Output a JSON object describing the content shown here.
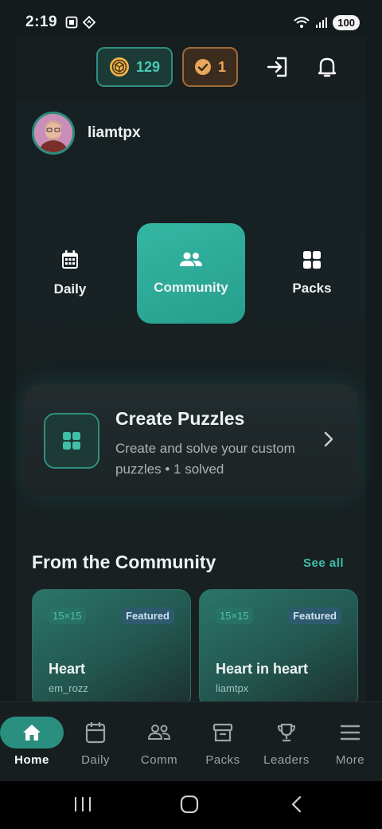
{
  "status_bar": {
    "time": "2:19",
    "battery": "100"
  },
  "header": {
    "coins": "129",
    "solved_badge": "1"
  },
  "profile": {
    "username": "liamtpx"
  },
  "modes": [
    {
      "label": "Daily"
    },
    {
      "label": "Community"
    },
    {
      "label": "Packs"
    }
  ],
  "create_card": {
    "title": "Create Puzzles",
    "subtitle": "Create and solve your custom puzzles • 1 solved"
  },
  "community": {
    "title": "From the Community",
    "see_all": "See all",
    "puzzles": [
      {
        "size": "15×15",
        "badge": "Featured",
        "name": "Heart",
        "author": "em_rozz"
      },
      {
        "size": "15×15",
        "badge": "Featured",
        "name": "Heart in heart",
        "author": "liamtpx"
      }
    ]
  },
  "bottom_nav": [
    {
      "label": "Home",
      "icon": "home-icon"
    },
    {
      "label": "Daily",
      "icon": "calendar-icon"
    },
    {
      "label": "Comm",
      "icon": "people-icon"
    },
    {
      "label": "Packs",
      "icon": "archive-icon"
    },
    {
      "label": "Leaders",
      "icon": "trophy-icon"
    },
    {
      "label": "More",
      "icon": "menu-icon"
    }
  ],
  "colors": {
    "accent": "#2b8f7f",
    "accent_text": "#3fbfa8",
    "gold": "#e7a85b",
    "background": "#141b1d"
  }
}
